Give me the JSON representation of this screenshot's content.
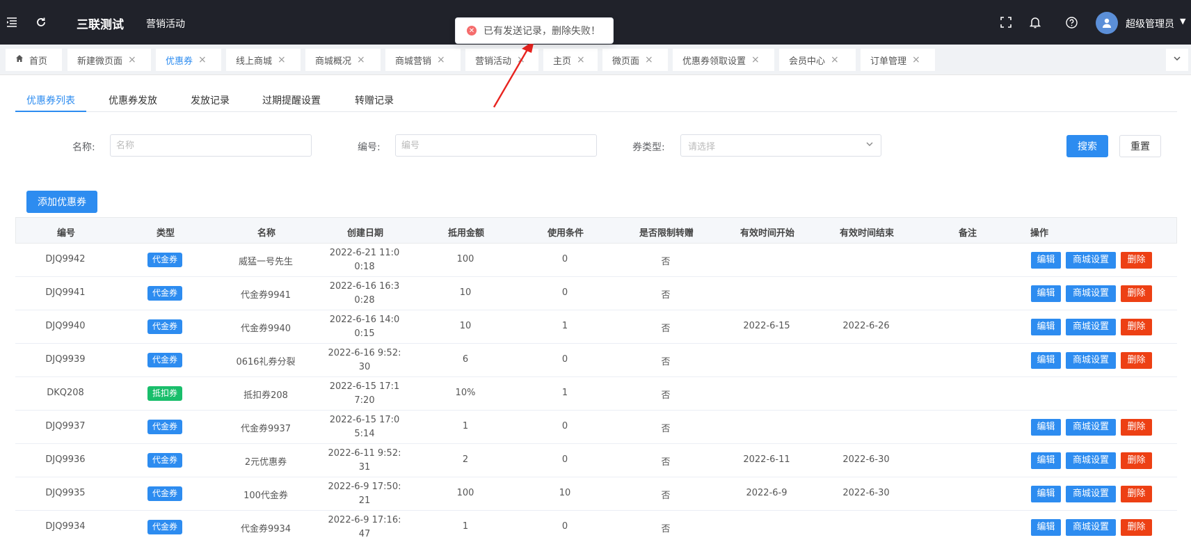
{
  "topbar": {
    "brand": "三联测试",
    "menu": "营销活动",
    "user": "超级管理员"
  },
  "toast": {
    "message": "已有发送记录，删除失败！"
  },
  "tabs": [
    {
      "label": "首页",
      "home": true
    },
    {
      "label": "新建微页面"
    },
    {
      "label": "优惠券",
      "active": true
    },
    {
      "label": "线上商城"
    },
    {
      "label": "商城概况"
    },
    {
      "label": "商城营销"
    },
    {
      "label": "营销活动"
    },
    {
      "label": "主页"
    },
    {
      "label": "微页面"
    },
    {
      "label": "优惠券领取设置"
    },
    {
      "label": "会员中心"
    },
    {
      "label": "订单管理"
    }
  ],
  "subtabs": [
    "优惠券列表",
    "优惠券发放",
    "发放记录",
    "过期提醒设置",
    "转赠记录"
  ],
  "filters": {
    "name_label": "名称:",
    "name_placeholder": "名称",
    "code_label": "编号:",
    "code_placeholder": "编号",
    "type_label": "券类型:",
    "type_placeholder": "请选择",
    "search": "搜索",
    "reset": "重置"
  },
  "add_button": "添加优惠券",
  "table": {
    "headers": [
      "编号",
      "类型",
      "名称",
      "创建日期",
      "抵用金额",
      "使用条件",
      "是否限制转赠",
      "有效时间开始",
      "有效时间结束",
      "备注",
      "操作"
    ],
    "ops": {
      "edit": "编辑",
      "mall": "商城设置",
      "delete": "删除"
    },
    "rows": [
      {
        "code": "DJQ9942",
        "type": "代金券",
        "type_color": "blue",
        "name": "威猛一号先生",
        "date": "2022-6-21 11:00:18",
        "amount": "100",
        "cond": "0",
        "limit": "否",
        "start": "",
        "end": "",
        "remark": "",
        "ops": true
      },
      {
        "code": "DJQ9941",
        "type": "代金券",
        "type_color": "blue",
        "name": "代金券9941",
        "date": "2022-6-16 16:30:28",
        "amount": "10",
        "cond": "0",
        "limit": "否",
        "start": "",
        "end": "",
        "remark": "",
        "ops": true
      },
      {
        "code": "DJQ9940",
        "type": "代金券",
        "type_color": "blue",
        "name": "代金券9940",
        "date": "2022-6-16 14:00:15",
        "amount": "10",
        "cond": "1",
        "limit": "否",
        "start": "2022-6-15",
        "end": "2022-6-26",
        "remark": "",
        "ops": true
      },
      {
        "code": "DJQ9939",
        "type": "代金券",
        "type_color": "blue",
        "name": "0616礼券分裂",
        "date": "2022-6-16 9:52:30",
        "amount": "6",
        "cond": "0",
        "limit": "否",
        "start": "",
        "end": "",
        "remark": "",
        "ops": true
      },
      {
        "code": "DKQ208",
        "type": "抵扣券",
        "type_color": "green",
        "name": "抵扣券208",
        "date": "2022-6-15 17:17:20",
        "amount": "10%",
        "cond": "1",
        "limit": "否",
        "start": "",
        "end": "",
        "remark": "",
        "ops": false
      },
      {
        "code": "DJQ9937",
        "type": "代金券",
        "type_color": "blue",
        "name": "代金券9937",
        "date": "2022-6-15 17:05:14",
        "amount": "1",
        "cond": "0",
        "limit": "否",
        "start": "",
        "end": "",
        "remark": "",
        "ops": true
      },
      {
        "code": "DJQ9936",
        "type": "代金券",
        "type_color": "blue",
        "name": "2元优惠券",
        "date": "2022-6-11 9:52:31",
        "amount": "2",
        "cond": "0",
        "limit": "否",
        "start": "2022-6-11",
        "end": "2022-6-30",
        "remark": "",
        "ops": true
      },
      {
        "code": "DJQ9935",
        "type": "代金券",
        "type_color": "blue",
        "name": "100代金券",
        "date": "2022-6-9 17:50:21",
        "amount": "100",
        "cond": "10",
        "limit": "否",
        "start": "2022-6-9",
        "end": "2022-6-30",
        "remark": "",
        "ops": true
      },
      {
        "code": "DJQ9934",
        "type": "代金券",
        "type_color": "blue",
        "name": "代金券9934",
        "date": "2022-6-9 17:16:47",
        "amount": "1",
        "cond": "0",
        "limit": "否",
        "start": "",
        "end": "",
        "remark": "",
        "ops": true
      }
    ]
  }
}
